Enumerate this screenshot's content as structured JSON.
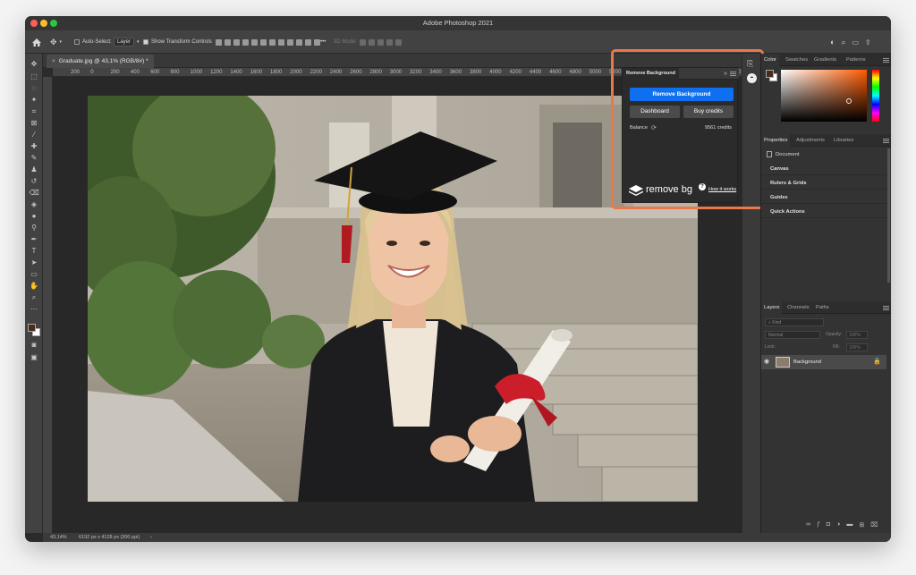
{
  "window": {
    "title": "Adobe Photoshop 2021"
  },
  "options_bar": {
    "auto_select_label": "Auto-Select:",
    "auto_select_value": "Layer",
    "show_transform_label": "Show Transform Controls",
    "mode_3d_label": "3D Mode:",
    "more_label": "•••"
  },
  "document_tab": {
    "label": "Graduate.jpg @ 43,1% (RGB/8#) *",
    "close": "×"
  },
  "ruler_ticks": [
    "200",
    "0",
    "200",
    "400",
    "600",
    "800",
    "1000",
    "1200",
    "1400",
    "1600",
    "1800",
    "2000",
    "2200",
    "2400",
    "2600",
    "2800",
    "3000",
    "3200",
    "3400",
    "3600",
    "3800",
    "4000",
    "4200",
    "4400",
    "4600",
    "4800",
    "5000",
    "5200",
    "5400",
    "5600",
    "5800",
    "6000",
    "6200",
    "6400"
  ],
  "status_bar": {
    "zoom": "43,14%",
    "info": "6192 px x 4128 px (300 ppi)",
    "arrow": "›"
  },
  "remove_bg_panel": {
    "tab_label": "Remove Background",
    "collapse": "»",
    "remove_button": "Remove Background",
    "dashboard_button": "Dashboard",
    "buy_button": "Buy credits",
    "balance_label": "Balance",
    "credits": "9561 credits",
    "logo_text": "remove bg",
    "how_link": "How it works",
    "help": "?"
  },
  "color_panel": {
    "tabs": [
      "Color",
      "Swatches",
      "Gradients",
      "Patterns"
    ],
    "fg_color": "#4a2a1c",
    "bg_color": "#ffffff"
  },
  "properties_panel": {
    "tabs": [
      "Properties",
      "Adjustments",
      "Libraries"
    ],
    "doc_label": "Document",
    "sections": [
      "Canvas",
      "Rulers & Grids",
      "Guides",
      "Quick Actions"
    ]
  },
  "layers_panel": {
    "tabs": [
      "Layers",
      "Channels",
      "Paths"
    ],
    "kind_label": "Kind",
    "blend_mode": "Normal",
    "opacity_label": "Opacity:",
    "opacity_value": "100%",
    "lock_label": "Lock:",
    "fill_label": "Fill:",
    "fill_value": "100%",
    "layer_name": "Background"
  },
  "colors": {
    "accent": "#0f6ff1",
    "highlight": "#e9784a"
  }
}
